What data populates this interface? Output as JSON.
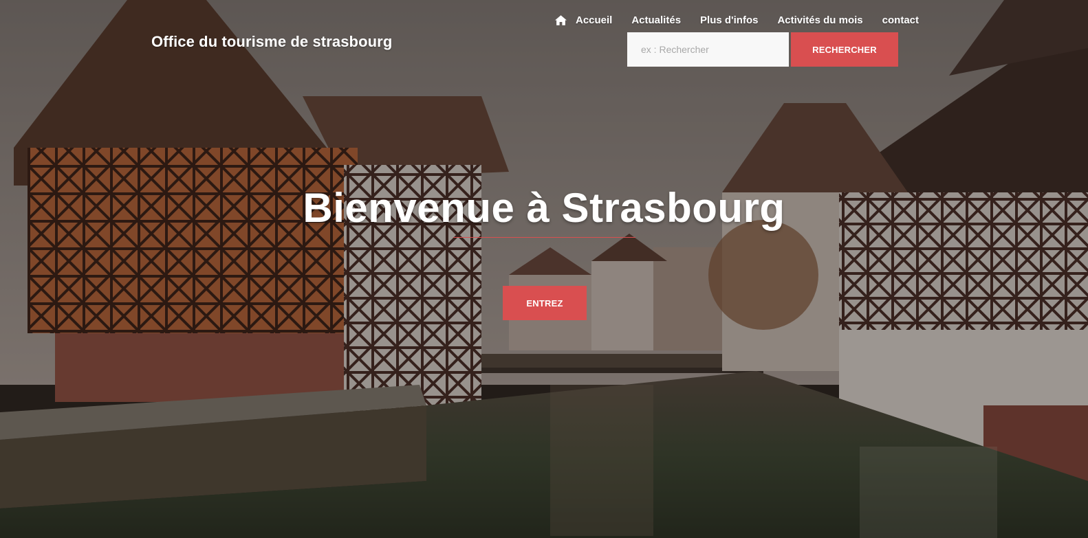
{
  "brand": {
    "title": "Office du tourisme de strasbourg"
  },
  "nav": {
    "home_icon": "home-icon",
    "items": [
      {
        "label": "Accueil"
      },
      {
        "label": "Actualités"
      },
      {
        "label": "Plus d'infos"
      },
      {
        "label": "Activités du mois"
      },
      {
        "label": "contact"
      }
    ]
  },
  "search": {
    "placeholder": "ex : Rechercher",
    "value": "",
    "button_label": "RECHERCHER"
  },
  "hero": {
    "title": "Bienvenue à Strasbourg",
    "button_label": "ENTREZ"
  },
  "colors": {
    "accent": "#d94f50",
    "text": "#ffffff",
    "input_bg": "#f8f8f8"
  }
}
